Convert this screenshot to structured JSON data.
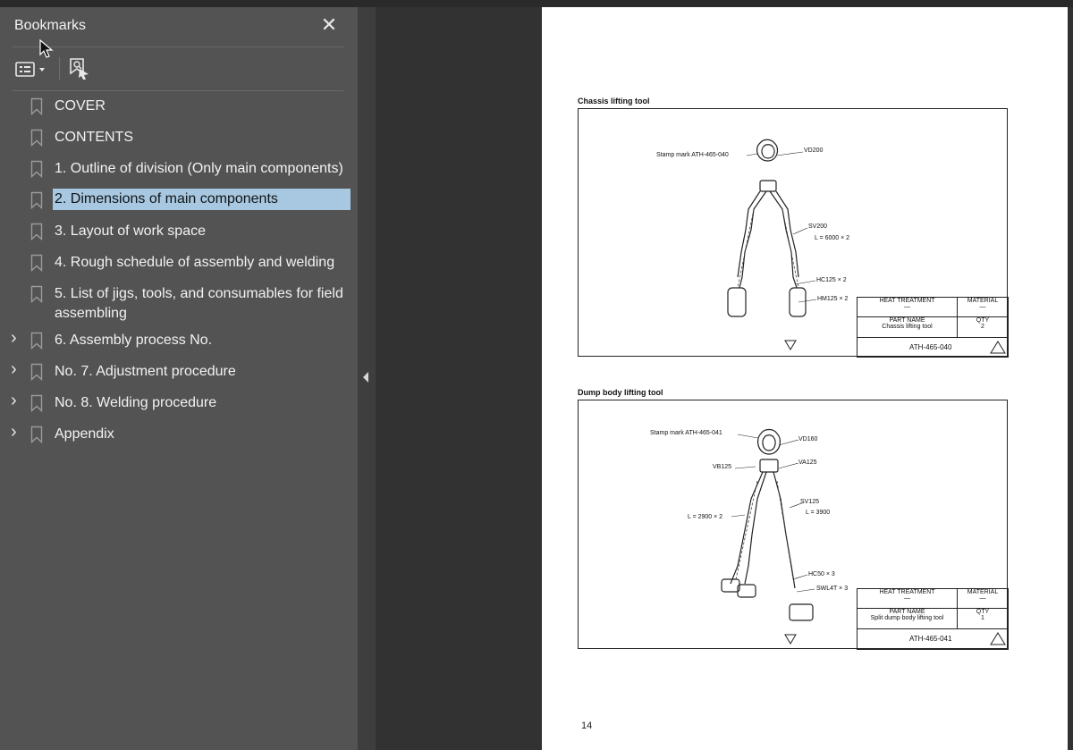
{
  "sidebar": {
    "title": "Bookmarks",
    "close": "✕",
    "items": [
      {
        "label": "COVER",
        "expandable": false
      },
      {
        "label": "CONTENTS",
        "expandable": false
      },
      {
        "label": "1. Outline of division (Only main components)",
        "expandable": false
      },
      {
        "label": "2. Dimensions of main components",
        "expandable": false,
        "selected": true
      },
      {
        "label": "3. Layout of work space",
        "expandable": false
      },
      {
        "label": "4. Rough schedule of assembly and welding",
        "expandable": false
      },
      {
        "label": "5. List of jigs, tools, and consumables for field assembling",
        "expandable": false
      },
      {
        "label": "6. Assembly process No.",
        "expandable": true
      },
      {
        "label": "No. 7. Adjustment procedure",
        "expandable": true
      },
      {
        "label": "No. 8. Welding procedure",
        "expandable": true
      },
      {
        "label": "Appendix",
        "expandable": true
      }
    ],
    "chevron": "›"
  },
  "document": {
    "page_number": "14",
    "fig1": {
      "title": "Chassis lifting tool",
      "labels": {
        "stamp": "Stamp mark  ATH-465-040",
        "vd": "VD200",
        "sv": "SV200",
        "length": "L = 6000 × 2",
        "hc": "HC125 × 2",
        "hm": "HM125 × 2"
      },
      "table": {
        "heat": "HEAT TREATMENT",
        "heat_val": "—",
        "material": "MATERIAL",
        "material_val": "—",
        "part_name_label": "PART NAME",
        "part_name": "Chassis lifting tool",
        "qty_label": "QTY",
        "qty": "2",
        "code": "ATH-465-040"
      }
    },
    "fig2": {
      "title": "Dump body lifting tool",
      "labels": {
        "stamp": "Stamp mark  ATH-465-041",
        "vd": "VD160",
        "vb": "VB125",
        "va": "VA125",
        "sv": "SV125",
        "length_right": "L = 3900",
        "length_left": "L = 2900 × 2",
        "hc": "HC50 × 3",
        "swl": "SWL4T × 3"
      },
      "table": {
        "heat": "HEAT TREATMENT",
        "heat_val": "—",
        "material": "MATERIAL",
        "material_val": "—",
        "part_name_label": "PART NAME",
        "part_name": "Split dump body lifting tool",
        "qty_label": "QTY",
        "qty": "1",
        "code": "ATH-465-041"
      }
    }
  },
  "colors": {
    "sidebar_bg": "#535353",
    "selection": "#a7c8e0",
    "viewer_bg": "#323232"
  }
}
